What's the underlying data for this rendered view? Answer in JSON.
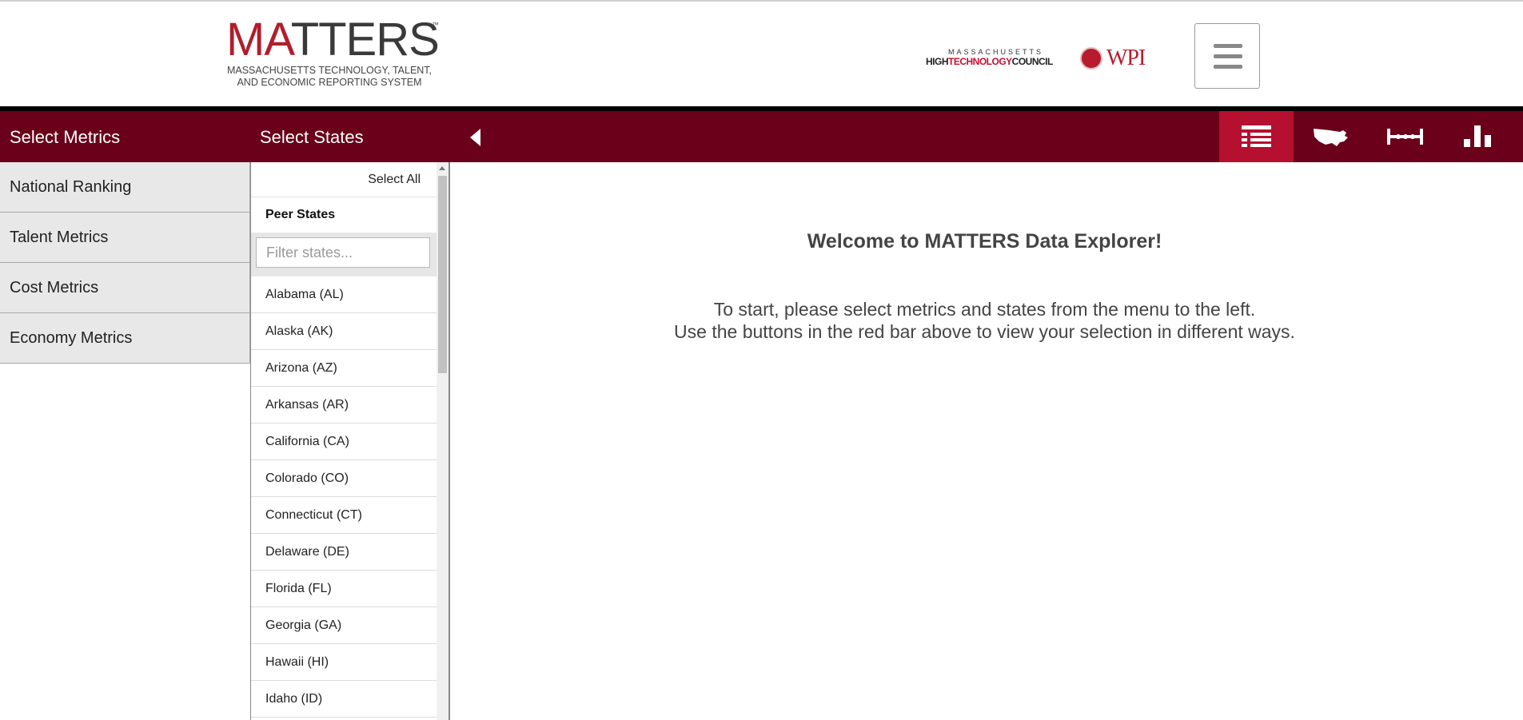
{
  "header": {
    "logo": {
      "ma": "MA",
      "tters": "TTERS",
      "tm": "™",
      "subtitle_line1": "MASSACHUSETTS TECHNOLOGY, TALENT,",
      "subtitle_line2": "AND ECONOMIC REPORTING SYSTEM"
    },
    "partner_htc": {
      "top": "MASSACHUSETTS",
      "high": "HIGH",
      "technology": "TECHNOLOGY",
      "council": "COUNCIL"
    },
    "partner_wpi": "WPI",
    "menu_icon": "hamburger-menu-icon"
  },
  "toolbar": {
    "select_metrics": "Select Metrics",
    "select_states": "Select States",
    "collapse_icon": "caret-left-icon",
    "views": [
      {
        "name": "table-view",
        "icon": "table-icon",
        "active": true
      },
      {
        "name": "map-view",
        "icon": "us-map-icon",
        "active": false
      },
      {
        "name": "range-view",
        "icon": "range-line-icon",
        "active": false
      },
      {
        "name": "bar-chart-view",
        "icon": "bar-chart-icon",
        "active": false
      }
    ],
    "colors": {
      "bar": "#6a0019",
      "active": "#b5102f"
    }
  },
  "metrics": [
    "National Ranking",
    "Talent Metrics",
    "Cost Metrics",
    "Economy Metrics"
  ],
  "states_panel": {
    "select_all": "Select All",
    "peer_states": "Peer States",
    "filter_placeholder": "Filter states...",
    "states": [
      "Alabama (AL)",
      "Alaska (AK)",
      "Arizona (AZ)",
      "Arkansas (AR)",
      "California (CA)",
      "Colorado (CO)",
      "Connecticut (CT)",
      "Delaware (DE)",
      "Florida (FL)",
      "Georgia (GA)",
      "Hawaii (HI)",
      "Idaho (ID)"
    ]
  },
  "main": {
    "welcome": "Welcome to MATTERS Data Explorer!",
    "instructions_line1": "To start, please select metrics and states from the menu to the left.",
    "instructions_line2": "Use the buttons in the red bar above to view your selection in different ways."
  }
}
